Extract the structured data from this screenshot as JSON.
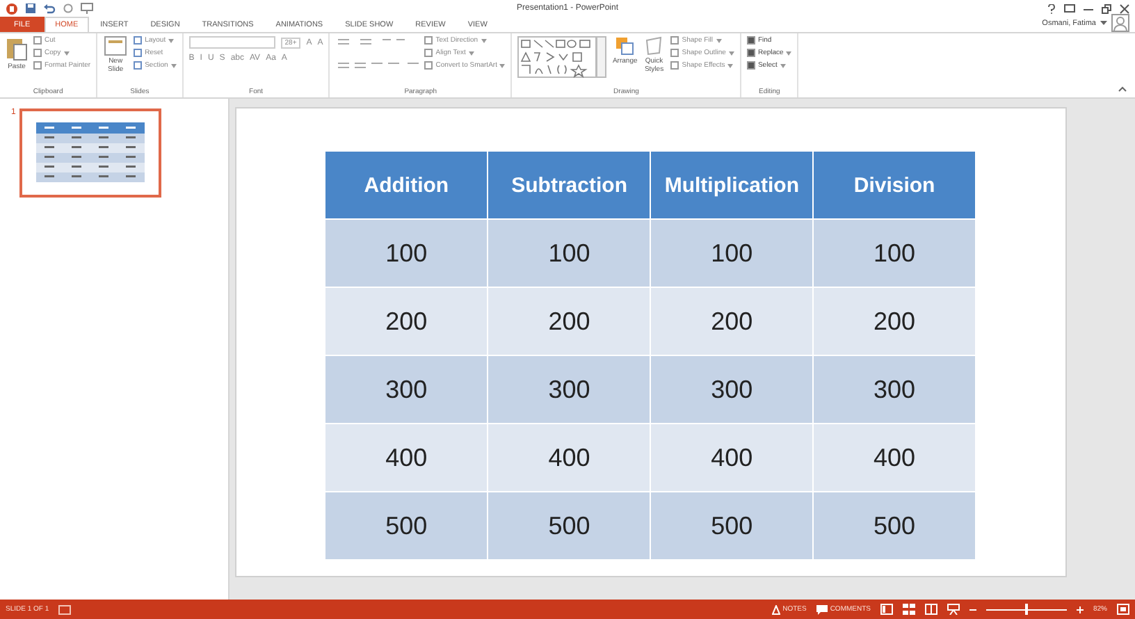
{
  "window": {
    "title": "Presentation1 - PowerPoint",
    "user": "Osmani, Fatima"
  },
  "tabs": [
    {
      "label": "FILE",
      "kind": "file",
      "selected": false
    },
    {
      "label": "HOME",
      "kind": "tab",
      "selected": true
    },
    {
      "label": "INSERT",
      "kind": "tab",
      "selected": false
    },
    {
      "label": "DESIGN",
      "kind": "tab",
      "selected": false
    },
    {
      "label": "TRANSITIONS",
      "kind": "tab",
      "selected": false
    },
    {
      "label": "ANIMATIONS",
      "kind": "tab",
      "selected": false
    },
    {
      "label": "SLIDE SHOW",
      "kind": "tab",
      "selected": false
    },
    {
      "label": "REVIEW",
      "kind": "tab",
      "selected": false
    },
    {
      "label": "VIEW",
      "kind": "tab",
      "selected": false
    }
  ],
  "ribbon": {
    "clipboard": {
      "title": "Clipboard",
      "big": "Paste",
      "items": [
        {
          "label": "Cut",
          "dropdown": false
        },
        {
          "label": "Copy",
          "dropdown": true
        },
        {
          "label": "Format Painter",
          "dropdown": false
        }
      ]
    },
    "slides": {
      "title": "Slides",
      "big": "New Slide",
      "items": [
        {
          "label": "Layout",
          "dropdown": true
        },
        {
          "label": "Reset",
          "dropdown": false
        },
        {
          "label": "Section",
          "dropdown": true
        }
      ]
    },
    "font": {
      "title": "Font",
      "size": "28+",
      "row1": [
        "A",
        "A"
      ],
      "row2": [
        "B",
        "I",
        "U",
        "S",
        "abc",
        "AV",
        "Aa",
        "A"
      ]
    },
    "paragraph": {
      "title": "Paragraph",
      "items": [
        {
          "label": "Text Direction",
          "dropdown": true
        },
        {
          "label": "Align Text",
          "dropdown": true
        },
        {
          "label": "Convert to SmartArt",
          "dropdown": true
        }
      ]
    },
    "drawing": {
      "title": "Drawing",
      "arrange": "Arrange",
      "quick": "Quick Styles",
      "items": [
        {
          "label": "Shape Fill",
          "dropdown": true
        },
        {
          "label": "Shape Outline",
          "dropdown": true
        },
        {
          "label": "Shape Effects",
          "dropdown": true
        }
      ]
    },
    "editing": {
      "title": "Editing",
      "items": [
        {
          "label": "Find",
          "dropdown": false
        },
        {
          "label": "Replace",
          "dropdown": true
        },
        {
          "label": "Select",
          "dropdown": true
        }
      ]
    }
  },
  "thumbnails": [
    {
      "number": "1",
      "selected": true
    }
  ],
  "table": {
    "columns": [
      "Addition",
      "Subtraction",
      "Multiplication",
      "Division"
    ],
    "rows": [
      [
        "100",
        "100",
        "100",
        "100"
      ],
      [
        "200",
        "200",
        "200",
        "200"
      ],
      [
        "300",
        "300",
        "300",
        "300"
      ],
      [
        "400",
        "400",
        "400",
        "400"
      ],
      [
        "500",
        "500",
        "500",
        "500"
      ]
    ]
  },
  "status_bar": {
    "slide": "SLIDE 1 OF 1",
    "notes": "NOTES",
    "comments": "COMMENTS",
    "zoom": "82%",
    "zoom_slider": {
      "level": 0.5
    }
  }
}
